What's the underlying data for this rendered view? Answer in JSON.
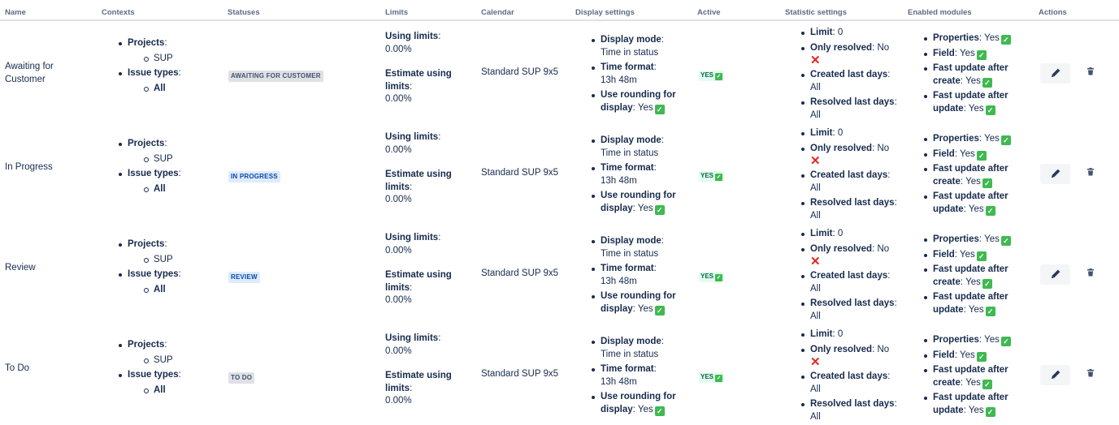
{
  "headers": {
    "name": "Name",
    "contexts": "Contexts",
    "statuses": "Statuses",
    "limits": "Limits",
    "calendar": "Calendar",
    "display_settings": "Display settings",
    "active": "Active",
    "statistic_settings": "Statistic settings",
    "enabled_modules": "Enabled modules",
    "actions": "Actions"
  },
  "labels": {
    "projects": "Projects",
    "issue_types": "Issue types",
    "using_limits": "Using limits",
    "estimate_using": "Estimate using",
    "limits_word": "limits",
    "display_mode": "Display mode",
    "time_format": "Time format",
    "use_rounding_for": "Use rounding for",
    "display_word": "display",
    "limit": "Limit",
    "only_resolved": "Only resolved",
    "created_last_days": "Created last days",
    "resolved_last_days": "Resolved last days",
    "properties": "Properties",
    "field": "Field",
    "fast_update_after": "Fast update after",
    "create_word": "create",
    "update_word": "update"
  },
  "rows": [
    {
      "name": "Awaiting for Customer",
      "project": "SUP",
      "issue_type": "All",
      "status": "AWAITING FOR CUSTOMER",
      "status_color": "grey",
      "using_limits": "0.00%",
      "estimate_limits": "0.00%",
      "calendar": "Standard SUP 9x5",
      "display_mode": "Time in status",
      "time_format": "13h 48m",
      "rounding": "Yes",
      "active": "YES",
      "limit": "0",
      "only_resolved": "No",
      "created_last_days": "All",
      "resolved_last_days": "All",
      "properties": "Yes",
      "field": "Yes",
      "fast_create": "Yes",
      "fast_update": "Yes"
    },
    {
      "name": "In Progress",
      "project": "SUP",
      "issue_type": "All",
      "status": "IN PROGRESS",
      "status_color": "blue",
      "using_limits": "0.00%",
      "estimate_limits": "0.00%",
      "calendar": "Standard SUP 9x5",
      "display_mode": "Time in status",
      "time_format": "13h 48m",
      "rounding": "Yes",
      "active": "YES",
      "limit": "0",
      "only_resolved": "No",
      "created_last_days": "All",
      "resolved_last_days": "All",
      "properties": "Yes",
      "field": "Yes",
      "fast_create": "Yes",
      "fast_update": "Yes"
    },
    {
      "name": "Review",
      "project": "SUP",
      "issue_type": "All",
      "status": "REVIEW",
      "status_color": "blue",
      "using_limits": "0.00%",
      "estimate_limits": "0.00%",
      "calendar": "Standard SUP 9x5",
      "display_mode": "Time in status",
      "time_format": "13h 48m",
      "rounding": "Yes",
      "active": "YES",
      "limit": "0",
      "only_resolved": "No",
      "created_last_days": "All",
      "resolved_last_days": "All",
      "properties": "Yes",
      "field": "Yes",
      "fast_create": "Yes",
      "fast_update": "Yes"
    },
    {
      "name": "To Do",
      "project": "SUP",
      "issue_type": "All",
      "status": "TO DO",
      "status_color": "grey",
      "using_limits": "0.00%",
      "estimate_limits": "0.00%",
      "calendar": "Standard SUP 9x5",
      "display_mode": "Time in status",
      "time_format": "13h 48m",
      "rounding": "Yes",
      "active": "YES",
      "limit": "0",
      "only_resolved": "No",
      "created_last_days": "All",
      "resolved_last_days": "All",
      "properties": "Yes",
      "field": "Yes",
      "fast_create": "Yes",
      "fast_update": "Yes"
    }
  ]
}
